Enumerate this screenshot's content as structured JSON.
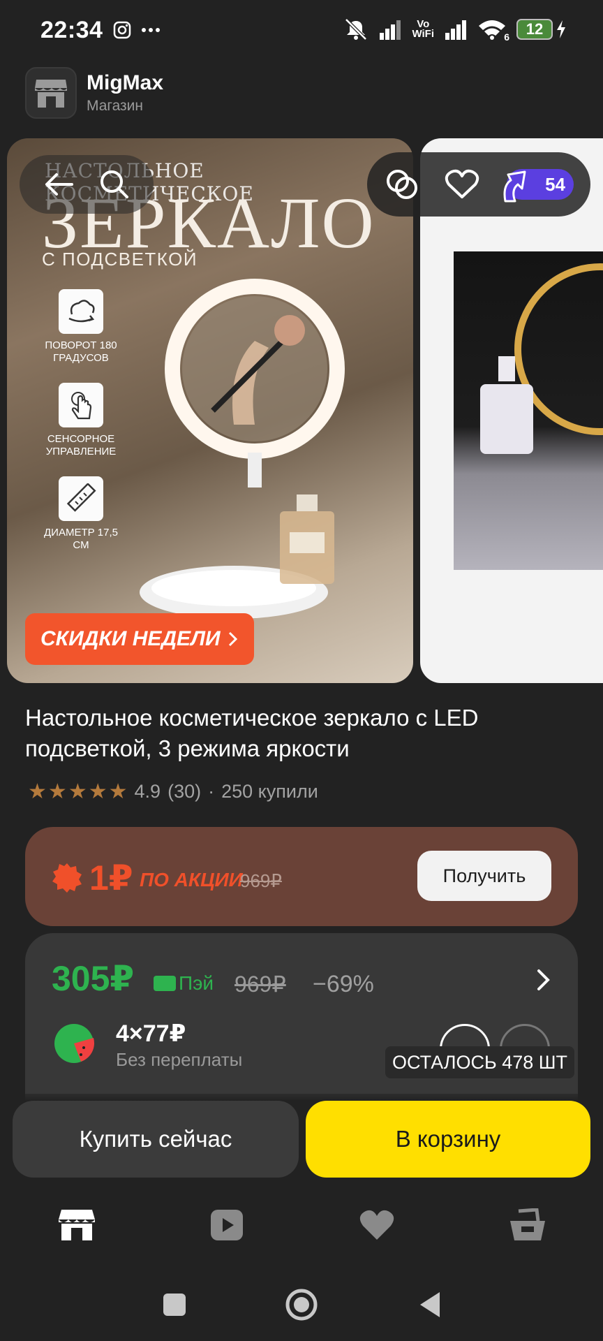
{
  "status_bar": {
    "time": "22:34",
    "left_icons": [
      "instagram-icon",
      "more-dots-icon"
    ],
    "right_icons": [
      "mute-icon",
      "signal-icon",
      "vowifi-icon",
      "signal-icon",
      "wifi-icon"
    ],
    "vowifi_top": "Vo",
    "vowifi_bottom": "WiFi",
    "wifi_label": "6",
    "battery": "12"
  },
  "store": {
    "name": "MigMax",
    "subtitle": "Магазин"
  },
  "gallery": {
    "promo_line1": "НАСТОЛЬНОЕ КОСМЕТИЧЕСКОЕ",
    "promo_line2": "ЗЕРКАЛО",
    "promo_line3": "С ПОДСВЕТКОЙ",
    "features": [
      {
        "icon": "rotate-icon",
        "text": "ПОВОРОТ 180 ГРАДУСОВ"
      },
      {
        "icon": "touch-icon",
        "text": "СЕНСОРНОЕ УПРАВЛЕНИЕ"
      },
      {
        "icon": "ruler-icon",
        "text": "ДИАМЕТР 17,5 СМ"
      }
    ],
    "badge": "СКИДКИ НЕДЕЛИ"
  },
  "toolbar": {
    "cashback": "54"
  },
  "product": {
    "title": "Настольное косметическое зеркало с LED подсветкой, 3 режима яркости",
    "rating": "4.9",
    "reviews": "(30)",
    "separator": "·",
    "bought": "250 купили"
  },
  "promo": {
    "price": "1₽",
    "label": "ПО АКЦИИ",
    "old_price": "969₽",
    "button": "Получить"
  },
  "pricing": {
    "price": "305₽",
    "pay_label": "Пэй",
    "old_price": "969₽",
    "discount": "−69%",
    "installment_amount": "4×77₽",
    "installment_note": "Без переплаты",
    "stock": "ОСТАЛОСЬ 478 ШТ"
  },
  "actions": {
    "buy_now": "Купить сейчас",
    "add_to_cart": "В корзину"
  },
  "colors": {
    "background": "#222222",
    "promo_card": "#6a4237",
    "accent_orange": "#f0502a",
    "price_green": "#2eb34f",
    "cart_yellow": "#ffdf00",
    "cashback_purple": "#5b3fe0"
  }
}
